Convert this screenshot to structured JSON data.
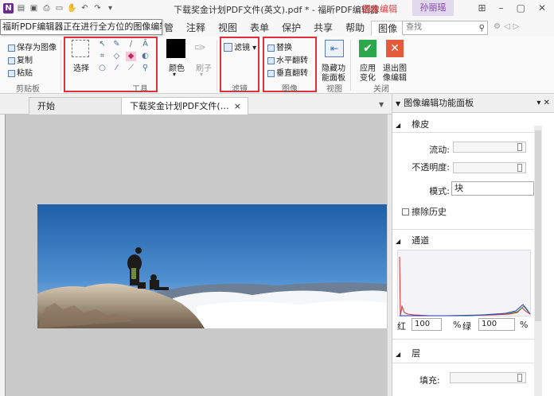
{
  "titlebar": {
    "title": "下载奖金计划PDF文件(英文).pdf * - 福昕PDF编辑器",
    "context_tab": "图像编辑",
    "user_name": "孙丽瑶",
    "controls": {
      "grid": "⊞",
      "minimize": "–",
      "restore": "▢",
      "close": "✕"
    }
  },
  "tooltip": "福昕PDF编辑器正在进行全方位的图像编辑！.png",
  "tabs": [
    "管",
    "注释",
    "视图",
    "表单",
    "保护",
    "共享",
    "帮助",
    "图像"
  ],
  "search": {
    "placeholder": "查找"
  },
  "ribbon": {
    "clipboard": {
      "save_as_image": "保存为图像",
      "copy": "复制",
      "paste": "粘贴",
      "group_label": "剪贴板"
    },
    "tools": {
      "select_label": "选择",
      "group_label": "工具"
    },
    "color": {
      "color_label": "颜色",
      "brush_label": "刷子"
    },
    "filter": {
      "filter_label": "滤镜",
      "group_label": "滤镜"
    },
    "image": {
      "replace": "替换",
      "flip_horizontal": "水平翻转",
      "flip_vertical": "垂直翻转",
      "group_label": "图像"
    },
    "view": {
      "hide_panel_line1": "隐藏功",
      "hide_panel_line2": "能面板",
      "group_label": "视图"
    },
    "close": {
      "apply_line1": "应用",
      "apply_line2": "变化",
      "exit_line1": "退出图",
      "exit_line2": "像编辑",
      "group_label": "关闭"
    }
  },
  "doc_tabs": {
    "start": "开始",
    "document": "下载奖金计划PDF文件(…",
    "close": "×"
  },
  "panel": {
    "title": "图像编辑功能面板",
    "eraser": {
      "header": "橡皮",
      "flow_label": "流动:",
      "opacity_label": "不透明度:",
      "mode_label": "模式:",
      "mode_value": "块",
      "erase_history_label": "擦除历史"
    },
    "channel": {
      "header": "通道",
      "red_label": "红",
      "red_value": "100",
      "pct1": "%",
      "green_label": "绿",
      "green_value": "100",
      "pct2": "%"
    },
    "layer": {
      "header": "层",
      "fill_label": "填充:"
    }
  },
  "colors": {
    "accent_red": "#e0303a",
    "context_red": "#e04040",
    "panel_bg": "#ffffff",
    "canvas_bg": "#c9c9c9"
  }
}
